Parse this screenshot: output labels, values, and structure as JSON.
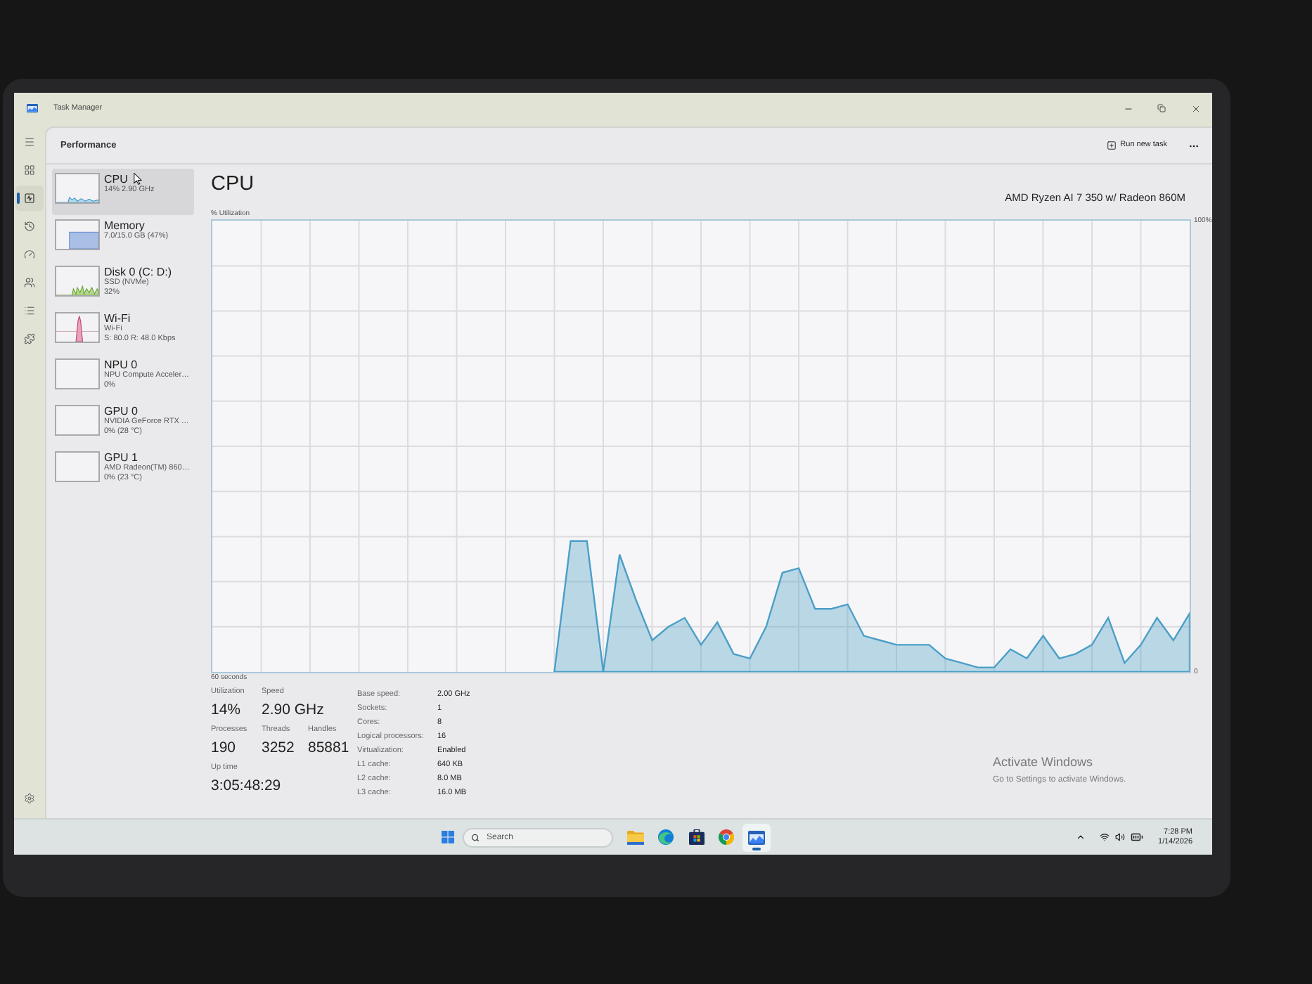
{
  "window": {
    "title": "Task Manager"
  },
  "nav_rail": [
    {
      "kind": "processes",
      "selected": false
    },
    {
      "kind": "performance",
      "selected": true
    },
    {
      "kind": "app_history",
      "selected": false
    },
    {
      "kind": "startup",
      "selected": false
    },
    {
      "kind": "users",
      "selected": false
    },
    {
      "kind": "details",
      "selected": false
    },
    {
      "kind": "services",
      "selected": false
    }
  ],
  "header": {
    "title": "Performance",
    "run_new_task": "Run new task"
  },
  "devices": [
    {
      "kind": "cpu",
      "name": "CPU",
      "details": [
        "14% 2.90 GHz"
      ],
      "selected": true
    },
    {
      "kind": "memory",
      "name": "Memory",
      "details": [
        "7.0/15.0 GB (47%)"
      ],
      "selected": false
    },
    {
      "kind": "disk",
      "name": "Disk 0 (C: D:)",
      "details": [
        "SSD (NVMe)",
        "32%"
      ],
      "selected": false
    },
    {
      "kind": "network",
      "name": "Wi-Fi",
      "details": [
        "Wi-Fi",
        "S: 80.0 R: 48.0 Kbps"
      ],
      "selected": false
    },
    {
      "kind": "npu",
      "name": "NPU 0",
      "details": [
        "NPU Compute Acceler…",
        "0%"
      ],
      "selected": false
    },
    {
      "kind": "gpu",
      "name": "GPU 0",
      "details": [
        "NVIDIA GeForce RTX …",
        "0% (28 °C)"
      ],
      "selected": false
    },
    {
      "kind": "gpu",
      "name": "GPU 1",
      "details": [
        "AMD Radeon(TM) 860…",
        "0% (23 °C)"
      ],
      "selected": false
    }
  ],
  "cpu_panel": {
    "model": "AMD Ryzen AI 7 350 w/ Radeon 860M",
    "chart_data": {
      "type": "area",
      "title": "CPU",
      "ylabel": "% Utilization",
      "xlabel": "60 seconds",
      "grid": true,
      "categories": [
        null,
        null,
        null,
        null,
        null,
        null,
        null,
        null,
        null,
        null,
        null,
        null,
        null,
        null,
        null,
        null,
        null,
        null,
        null,
        null,
        null,
        null,
        null,
        null,
        null,
        null,
        null,
        null,
        null,
        null,
        null,
        null,
        null,
        null,
        null,
        null,
        null,
        null,
        null,
        null,
        null,
        null,
        null,
        null,
        null,
        null,
        null,
        null,
        null,
        null,
        null,
        null,
        null,
        null,
        null,
        null,
        null,
        null,
        null,
        null,
        null
      ],
      "ylim": [
        0,
        100
      ],
      "yticks": [
        {
          "value": 0,
          "label": "0"
        },
        {
          "value": 100,
          "label": "100%"
        }
      ],
      "series": [
        {
          "color": "#4b9fc6",
          "values": [
            null,
            null,
            null,
            null,
            null,
            null,
            null,
            null,
            null,
            null,
            null,
            null,
            null,
            null,
            null,
            null,
            null,
            null,
            null,
            null,
            null,
            0,
            29,
            29,
            0,
            26,
            16,
            7,
            10,
            12,
            6,
            11,
            4,
            3,
            10,
            22,
            23,
            14,
            14,
            15,
            8,
            7,
            6,
            6,
            6,
            3,
            2,
            1,
            1,
            5,
            3,
            8,
            3,
            4,
            6,
            12,
            2,
            6,
            12,
            7,
            13
          ]
        }
      ]
    },
    "stat_rows": [
      [
        {
          "label": "Utilization",
          "value": "14%"
        },
        {
          "label": "Speed",
          "value": "2.90 GHz"
        }
      ],
      [
        {
          "label": "Processes",
          "value": "190"
        },
        {
          "label": "Threads",
          "value": "3252"
        },
        {
          "label": "Handles",
          "value": "85881"
        }
      ],
      [
        {
          "label": "Up time",
          "value": "3:05:48:29"
        }
      ]
    ],
    "specs": [
      {
        "label": "Base speed:",
        "value": "2.00 GHz"
      },
      {
        "label": "Sockets:",
        "value": "1"
      },
      {
        "label": "Cores:",
        "value": "8"
      },
      {
        "label": "Logical processors:",
        "value": "16"
      },
      {
        "label": "Virtualization:",
        "value": "Enabled"
      },
      {
        "label": "L1 cache:",
        "value": "640 KB"
      },
      {
        "label": "L2 cache:",
        "value": "8.0 MB"
      },
      {
        "label": "L3 cache:",
        "value": "16.0 MB"
      }
    ]
  },
  "activation_notice": {
    "title": "Activate Windows",
    "text": "Go to Settings to activate Windows."
  },
  "taskbar": {
    "search": {
      "placeholder": "Search"
    },
    "apps": [
      {
        "kind": "file_explorer",
        "active": false
      },
      {
        "kind": "edge",
        "active": false
      },
      {
        "kind": "store",
        "active": false
      },
      {
        "kind": "chrome",
        "active": false
      },
      {
        "kind": "task_manager",
        "active": true
      }
    ],
    "time": "7:28 PM",
    "date": "1/14/2026"
  }
}
